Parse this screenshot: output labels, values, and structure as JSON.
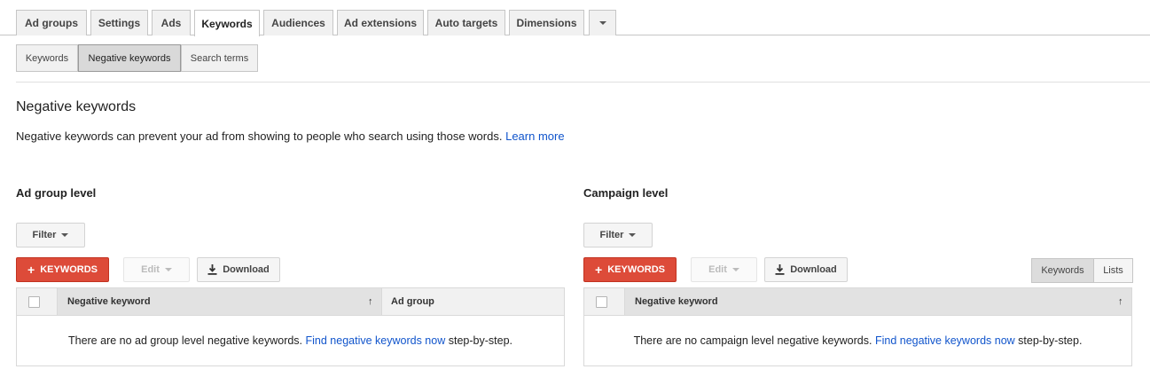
{
  "tabs": [
    {
      "label": "Ad groups"
    },
    {
      "label": "Settings"
    },
    {
      "label": "Ads"
    },
    {
      "label": "Keywords",
      "active": true
    },
    {
      "label": "Audiences"
    },
    {
      "label": "Ad extensions"
    },
    {
      "label": "Auto targets"
    },
    {
      "label": "Dimensions"
    }
  ],
  "subtabs": [
    {
      "label": "Keywords"
    },
    {
      "label": "Negative keywords",
      "active": true
    },
    {
      "label": "Search terms"
    }
  ],
  "page": {
    "title": "Negative keywords",
    "description": "Negative keywords can prevent your ad from showing to people who search using those words.",
    "learn_more": "Learn more"
  },
  "ad_group": {
    "title": "Ad group level",
    "filter": "Filter",
    "add_keywords": "KEYWORDS",
    "edit": "Edit",
    "download": "Download",
    "columns": [
      "Negative keyword",
      "Ad group"
    ],
    "sort_arrow": "↑",
    "empty_prefix": "There are no ad group level negative keywords.",
    "empty_link": "Find negative keywords now",
    "empty_suffix": "step-by-step."
  },
  "campaign": {
    "title": "Campaign level",
    "filter": "Filter",
    "add_keywords": "KEYWORDS",
    "edit": "Edit",
    "download": "Download",
    "view_toggle": [
      "Keywords",
      "Lists"
    ],
    "columns": [
      "Negative keyword"
    ],
    "sort_arrow": "↑",
    "empty_prefix": "There are no campaign level negative keywords.",
    "empty_link": "Find negative keywords now",
    "empty_suffix": "step-by-step."
  },
  "colors": {
    "accent_red": "#dd4b39",
    "link_blue": "#1155cc"
  }
}
